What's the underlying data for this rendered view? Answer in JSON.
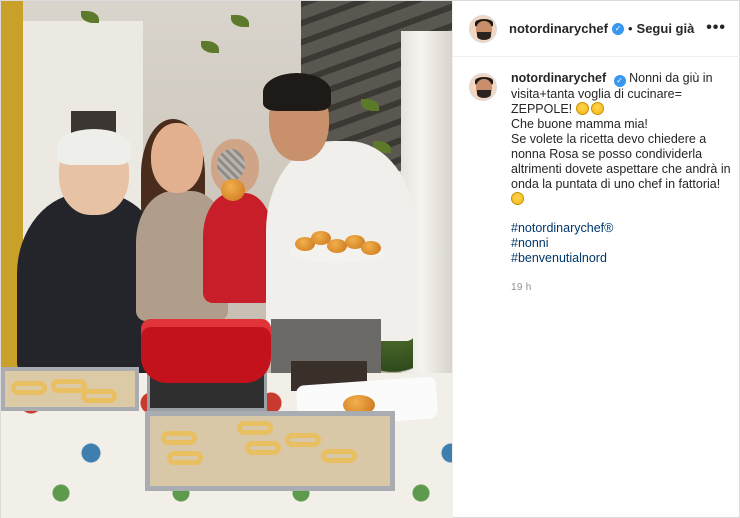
{
  "post": {
    "author": "notordinarychef",
    "follow_label": "Segui già",
    "separator": "•",
    "more_label": "•••",
    "caption": {
      "line1": "Nonni da giù in visita+tanta voglia di cucinare= ZEPPOLE!",
      "line2": "Che buone mamma mia!",
      "line3": "Se volete la ricetta devo chiedere a nonna Rosa se posso condividerla altrimenti dovete aspettare che andrà in onda la puntata di uno chef in fattoria!"
    },
    "hashtags": [
      "#notordinarychef®",
      "#nonni",
      "#benvenutialnord"
    ],
    "time": "19 h"
  },
  "icons": {
    "verified": "verified-badge-icon",
    "more": "more-options-icon",
    "emoji": "smiling-face-emoji"
  },
  "colors": {
    "link": "#00376b",
    "verified": "#3897f0",
    "muted": "#8e8e8e"
  }
}
